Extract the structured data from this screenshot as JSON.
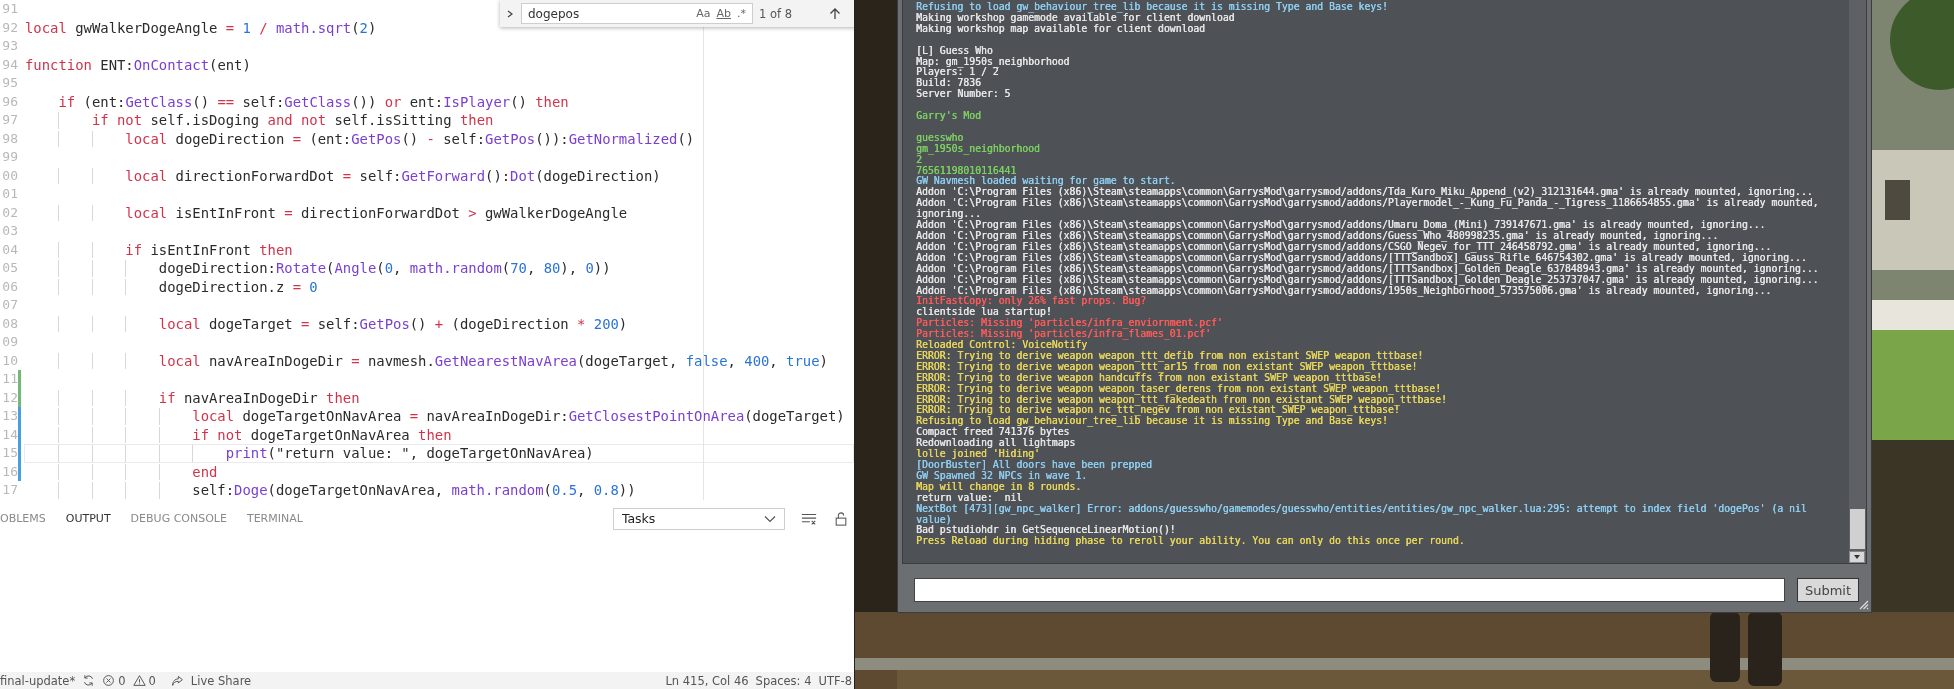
{
  "editor": {
    "lines": [
      {
        "number": "91",
        "current": false
      },
      {
        "number": "92",
        "current": false,
        "tokens": [
          {
            "kind": "keyword",
            "text": "local"
          },
          {
            "kind": "plain",
            "text": " gwWalkerDogeAngle"
          },
          {
            "kind": "operator",
            "text": " = "
          },
          {
            "kind": "number",
            "text": "1"
          },
          {
            "kind": "operator",
            "text": " / "
          },
          {
            "kind": "function",
            "text": "math.sqrt"
          },
          {
            "kind": "plain",
            "text": "("
          },
          {
            "kind": "number",
            "text": "2"
          },
          {
            "kind": "plain",
            "text": ")"
          }
        ]
      },
      {
        "number": "93",
        "current": false
      },
      {
        "number": "94",
        "current": false,
        "tokens": [
          {
            "kind": "keyword",
            "text": "function"
          },
          {
            "kind": "plain",
            "text": " ENT:"
          },
          {
            "kind": "function",
            "text": "OnContact"
          },
          {
            "kind": "plain",
            "text": "(ent)"
          }
        ]
      },
      {
        "number": "95",
        "current": false
      },
      {
        "number": "96",
        "current": false,
        "tokens": [
          {
            "kind": "keyword",
            "text": "    if"
          },
          {
            "kind": "plain",
            "text": " (ent:"
          },
          {
            "kind": "function",
            "text": "GetClass"
          },
          {
            "kind": "plain",
            "text": "()"
          },
          {
            "kind": "operator",
            "text": " == "
          },
          {
            "kind": "plain",
            "text": "self:"
          },
          {
            "kind": "function",
            "text": "GetClass"
          },
          {
            "kind": "plain",
            "text": "()) "
          },
          {
            "kind": "keyword",
            "text": "or"
          },
          {
            "kind": "plain",
            "text": " ent:"
          },
          {
            "kind": "function",
            "text": "IsPlayer"
          },
          {
            "kind": "plain",
            "text": "() "
          },
          {
            "kind": "keyword",
            "text": "then"
          }
        ]
      },
      {
        "number": "97",
        "current": false,
        "tokens": [
          {
            "kind": "keyword",
            "text": "        if not"
          },
          {
            "kind": "plain",
            "text": " self.isDoging "
          },
          {
            "kind": "keyword",
            "text": "and not"
          },
          {
            "kind": "plain",
            "text": " self.isSitting "
          },
          {
            "kind": "keyword",
            "text": "then"
          }
        ]
      },
      {
        "number": "98",
        "current": false,
        "tokens": [
          {
            "kind": "keyword",
            "text": "            local"
          },
          {
            "kind": "plain",
            "text": " dogeDirection"
          },
          {
            "kind": "operator",
            "text": " = "
          },
          {
            "kind": "plain",
            "text": "(ent:"
          },
          {
            "kind": "function",
            "text": "GetPos"
          },
          {
            "kind": "plain",
            "text": "()"
          },
          {
            "kind": "operator",
            "text": " - "
          },
          {
            "kind": "plain",
            "text": "self:"
          },
          {
            "kind": "function",
            "text": "GetPos"
          },
          {
            "kind": "plain",
            "text": "()):"
          },
          {
            "kind": "function",
            "text": "GetNormalized"
          },
          {
            "kind": "plain",
            "text": "()"
          }
        ]
      },
      {
        "number": "99",
        "current": false
      },
      {
        "number": "00",
        "current": false,
        "tokens": [
          {
            "kind": "keyword",
            "text": "            local"
          },
          {
            "kind": "plain",
            "text": " directionForwardDot"
          },
          {
            "kind": "operator",
            "text": " = "
          },
          {
            "kind": "plain",
            "text": "self:"
          },
          {
            "kind": "function",
            "text": "GetForward"
          },
          {
            "kind": "plain",
            "text": "():"
          },
          {
            "kind": "function",
            "text": "Dot"
          },
          {
            "kind": "plain",
            "text": "(dogeDirection)"
          }
        ]
      },
      {
        "number": "01",
        "current": false
      },
      {
        "number": "02",
        "current": false,
        "tokens": [
          {
            "kind": "keyword",
            "text": "            local"
          },
          {
            "kind": "plain",
            "text": " isEntInFront"
          },
          {
            "kind": "operator",
            "text": " = "
          },
          {
            "kind": "plain",
            "text": "directionForwardDot"
          },
          {
            "kind": "operator",
            "text": " > "
          },
          {
            "kind": "plain",
            "text": "gwWalkerDogeAngle"
          }
        ]
      },
      {
        "number": "03",
        "current": false
      },
      {
        "number": "04",
        "current": false,
        "tokens": [
          {
            "kind": "keyword",
            "text": "            if"
          },
          {
            "kind": "plain",
            "text": " isEntInFront "
          },
          {
            "kind": "keyword",
            "text": "then"
          }
        ]
      },
      {
        "number": "05",
        "current": false,
        "tokens": [
          {
            "kind": "plain",
            "text": "                dogeDirection:"
          },
          {
            "kind": "function",
            "text": "Rotate"
          },
          {
            "kind": "plain",
            "text": "("
          },
          {
            "kind": "function",
            "text": "Angle"
          },
          {
            "kind": "plain",
            "text": "("
          },
          {
            "kind": "number",
            "text": "0"
          },
          {
            "kind": "plain",
            "text": ", "
          },
          {
            "kind": "function",
            "text": "math.random"
          },
          {
            "kind": "plain",
            "text": "("
          },
          {
            "kind": "number",
            "text": "70"
          },
          {
            "kind": "plain",
            "text": ", "
          },
          {
            "kind": "number",
            "text": "80"
          },
          {
            "kind": "plain",
            "text": "), "
          },
          {
            "kind": "number",
            "text": "0"
          },
          {
            "kind": "plain",
            "text": "))"
          }
        ]
      },
      {
        "number": "06",
        "current": false,
        "tokens": [
          {
            "kind": "plain",
            "text": "                dogeDirection.z"
          },
          {
            "kind": "operator",
            "text": " = "
          },
          {
            "kind": "number",
            "text": "0"
          }
        ]
      },
      {
        "number": "07",
        "current": false
      },
      {
        "number": "08",
        "current": false,
        "tokens": [
          {
            "kind": "keyword",
            "text": "                local"
          },
          {
            "kind": "plain",
            "text": " dogeTarget"
          },
          {
            "kind": "operator",
            "text": " = "
          },
          {
            "kind": "plain",
            "text": "self:"
          },
          {
            "kind": "function",
            "text": "GetPos"
          },
          {
            "kind": "plain",
            "text": "()"
          },
          {
            "kind": "operator",
            "text": " + "
          },
          {
            "kind": "plain",
            "text": "(dogeDirection"
          },
          {
            "kind": "operator",
            "text": " * "
          },
          {
            "kind": "number",
            "text": "200"
          },
          {
            "kind": "plain",
            "text": ")"
          }
        ]
      },
      {
        "number": "09",
        "current": false
      },
      {
        "number": "10",
        "current": false,
        "tokens": [
          {
            "kind": "keyword",
            "text": "                local"
          },
          {
            "kind": "plain",
            "text": " navAreaInDogeDir"
          },
          {
            "kind": "operator",
            "text": " = "
          },
          {
            "kind": "plain",
            "text": "navmesh."
          },
          {
            "kind": "function",
            "text": "GetNearestNavArea"
          },
          {
            "kind": "plain",
            "text": "(dogeTarget, "
          },
          {
            "kind": "number",
            "text": "false"
          },
          {
            "kind": "plain",
            "text": ", "
          },
          {
            "kind": "number",
            "text": "400"
          },
          {
            "kind": "plain",
            "text": ", "
          },
          {
            "kind": "number",
            "text": "true"
          },
          {
            "kind": "plain",
            "text": ")"
          }
        ]
      },
      {
        "number": "11",
        "current": false,
        "kind": "added"
      },
      {
        "number": "12",
        "current": false,
        "kind": "added",
        "tokens": [
          {
            "kind": "keyword",
            "text": "                if"
          },
          {
            "kind": "plain",
            "text": " navAreaInDogeDir "
          },
          {
            "kind": "keyword",
            "text": "then"
          }
        ]
      },
      {
        "number": "13",
        "current": false,
        "kind": "modified",
        "tokens": [
          {
            "kind": "keyword",
            "text": "                    local"
          },
          {
            "kind": "plain",
            "text": " dogeTargetOnNavArea"
          },
          {
            "kind": "operator",
            "text": " = "
          },
          {
            "kind": "plain",
            "text": "navAreaInDogeDir:"
          },
          {
            "kind": "function",
            "text": "GetClosestPointOnArea"
          },
          {
            "kind": "plain",
            "text": "(dogeTarget)"
          }
        ]
      },
      {
        "number": "14",
        "current": false,
        "kind": "modified",
        "tokens": [
          {
            "kind": "keyword",
            "text": "                    if not"
          },
          {
            "kind": "plain",
            "text": " dogeTargetOnNavArea "
          },
          {
            "kind": "keyword",
            "text": "then"
          }
        ]
      },
      {
        "number": "15",
        "current": true,
        "kind": "modified",
        "tokens": [
          {
            "kind": "function",
            "text": "                        print"
          },
          {
            "kind": "plain",
            "text": "("
          },
          {
            "kind": "string",
            "text": "\"return value: \""
          },
          {
            "kind": "plain",
            "text": ", dogeTargetOnNavArea)"
          }
        ]
      },
      {
        "number": "16",
        "current": false,
        "kind": "modified",
        "tokens": [
          {
            "kind": "keyword",
            "text": "                    end"
          }
        ]
      },
      {
        "number": "17",
        "current": false,
        "tokens": [
          {
            "kind": "plain",
            "text": "                    self:"
          },
          {
            "kind": "function",
            "text": "Doge"
          },
          {
            "kind": "plain",
            "text": "(dogeTargetOnNavArea, "
          },
          {
            "kind": "function",
            "text": "math.random"
          },
          {
            "kind": "plain",
            "text": "("
          },
          {
            "kind": "number",
            "text": "0.5"
          },
          {
            "kind": "plain",
            "text": ", "
          },
          {
            "kind": "number",
            "text": "0.8"
          },
          {
            "kind": "plain",
            "text": "))"
          }
        ]
      }
    ]
  },
  "find_widget": {
    "query": "dogepos",
    "options": [
      "Aa",
      "Ab",
      ".*"
    ],
    "result": "1 of 8"
  },
  "panel": {
    "tabs": [
      {
        "label": "OBLEMS",
        "selected": false
      },
      {
        "label": "OUTPUT",
        "selected": true
      },
      {
        "label": "DEBUG CONSOLE",
        "selected": false
      },
      {
        "label": "TERMINAL",
        "selected": false
      }
    ],
    "dropdown": "Tasks"
  },
  "status_bar": {
    "branch": "final-update*",
    "errors": "0",
    "warnings": "0",
    "live_share": "Live Share",
    "position": "Ln 415, Col 46",
    "indentation": "Spaces: 4",
    "encoding": "UTF-8"
  },
  "console": {
    "lines": [
      {
        "kind": "text",
        "color": "#8ecdf0",
        "text": "Refusing to load gw_behaviour_tree_lib because it is missing Type and Base keys!"
      },
      {
        "kind": "text",
        "color": "#e6e6e6",
        "text": "Making workshop gamemode available for client download"
      },
      {
        "kind": "text",
        "color": "#e6e6e6",
        "text": "Making workshop map available for client download"
      },
      {
        "kind": "blank"
      },
      {
        "kind": "text",
        "color": "#e6e6e6",
        "text": "[L] Guess Who"
      },
      {
        "kind": "text",
        "color": "#e6e6e6",
        "text": "Map: gm_1950s_neighborhood"
      },
      {
        "kind": "text",
        "color": "#e6e6e6",
        "text": "Players: 1 / 2"
      },
      {
        "kind": "text",
        "color": "#e6e6e6",
        "text": "Build: 7836"
      },
      {
        "kind": "text",
        "color": "#e6e6e6",
        "text": "Server Number: 5"
      },
      {
        "kind": "blank"
      },
      {
        "kind": "text",
        "color": "#7ccf62",
        "text": "Garry's Mod"
      },
      {
        "kind": "blank"
      },
      {
        "kind": "text",
        "color": "#7ccf62",
        "text": "guesswho"
      },
      {
        "kind": "text",
        "color": "#7ccf62",
        "text": "gm_1950s_neighborhood"
      },
      {
        "kind": "text",
        "color": "#7ccf62",
        "text": "2"
      },
      {
        "kind": "text",
        "color": "#7ccf62",
        "text": "76561198010116441"
      },
      {
        "kind": "text",
        "color": "#8ecdf0",
        "text": "GW Navmesh loaded waiting for game to start."
      },
      {
        "kind": "text",
        "color": "#e6e6e6",
        "text": "Addon 'C:\\Program Files (x86)\\Steam\\steamapps\\common\\GarrysMod\\garrysmod/addons/Tda_Kuro_Miku_Append_(v2)_312131644.gma' is already mounted, ignoring..."
      },
      {
        "kind": "text",
        "color": "#e6e6e6",
        "text": "Addon 'C:\\Program Files (x86)\\Steam\\steamapps\\common\\GarrysMod\\garrysmod/addons/Playermodel_-_Kung_Fu_Panda_-_Tigress_1186654855.gma' is already mounted, ignoring..."
      },
      {
        "kind": "text",
        "color": "#e6e6e6",
        "text": "Addon 'C:\\Program Files (x86)\\Steam\\steamapps\\common\\GarrysMod\\garrysmod/addons/Umaru_Doma_(Mini)_739147671.gma' is already mounted, ignoring..."
      },
      {
        "kind": "text",
        "color": "#e6e6e6",
        "text": "Addon 'C:\\Program Files (x86)\\Steam\\steamapps\\common\\GarrysMod\\garrysmod/addons/Guess_Who_480998235.gma' is already mounted, ignoring..."
      },
      {
        "kind": "text",
        "color": "#e6e6e6",
        "text": "Addon 'C:\\Program Files (x86)\\Steam\\steamapps\\common\\GarrysMod\\garrysmod/addons/CSGO_Negev_for_TTT_246458792.gma' is already mounted, ignoring..."
      },
      {
        "kind": "text",
        "color": "#e6e6e6",
        "text": "Addon 'C:\\Program Files (x86)\\Steam\\steamapps\\common\\GarrysMod\\garrysmod/addons/[TTTSandbox]_Gauss_Rifle_646754302.gma' is already mounted, ignoring..."
      },
      {
        "kind": "text",
        "color": "#e6e6e6",
        "text": "Addon 'C:\\Program Files (x86)\\Steam\\steamapps\\common\\GarrysMod\\garrysmod/addons/[TTTSandbox]_Golden_Deagle_637848943.gma' is already mounted, ignoring..."
      },
      {
        "kind": "text",
        "color": "#e6e6e6",
        "text": "Addon 'C:\\Program Files (x86)\\Steam\\steamapps\\common\\GarrysMod\\garrysmod/addons/[TTTSandbox]_Golden_Deagle_253737047.gma' is already mounted, ignoring..."
      },
      {
        "kind": "text",
        "color": "#e6e6e6",
        "text": "Addon 'C:\\Program Files (x86)\\Steam\\steamapps\\common\\GarrysMod\\garrysmod/addons/1950s_Neighborhood_573575006.gma' is already mounted, ignoring..."
      },
      {
        "kind": "text",
        "color": "#ff5a5a",
        "text": "InitFastCopy: only 26% fast props. Bug?"
      },
      {
        "kind": "text",
        "color": "#e6e6e6",
        "text": "clientside lua startup!"
      },
      {
        "kind": "text",
        "color": "#ff5a5a",
        "text": "Particles: Missing 'particles/infra_enviornment.pcf'"
      },
      {
        "kind": "text",
        "color": "#ff5a5a",
        "text": "Particles: Missing 'particles/infra_flames_01.pcf'"
      },
      {
        "kind": "text",
        "color": "#e8d65c",
        "text": "Reloaded Control: VoiceNotify"
      },
      {
        "kind": "text",
        "color": "#e8d65c",
        "text": "ERROR: Trying to derive weapon weapon_ttt_defib from non existant SWEP weapon_tttbase!"
      },
      {
        "kind": "text",
        "color": "#e8d65c",
        "text": "ERROR: Trying to derive weapon weapon_ttt_ar15 from non existant SWEP weapon_tttbase!"
      },
      {
        "kind": "text",
        "color": "#e8d65c",
        "text": "ERROR: Trying to derive weapon handcuffs from non existant SWEP weapon_tttbase!"
      },
      {
        "kind": "text",
        "color": "#e8d65c",
        "text": "ERROR: Trying to derive weapon weapon_taser_derens from non existant SWEP weapon_tttbase!"
      },
      {
        "kind": "text",
        "color": "#e8d65c",
        "text": "ERROR: Trying to derive weapon weapon_ttt_fakedeath from non existant SWEP weapon_tttbase!"
      },
      {
        "kind": "text",
        "color": "#e8d65c",
        "text": "ERROR: Trying to derive weapon nc_ttt_negev from non existant SWEP weapon_tttbase!"
      },
      {
        "kind": "text",
        "color": "#e8d65c",
        "text": "Refusing to load gw_behaviour_tree_lib because it is missing Type and Base keys!"
      },
      {
        "kind": "text",
        "color": "#e6e6e6",
        "text": "Compact freed 741376 bytes"
      },
      {
        "kind": "text",
        "color": "#e6e6e6",
        "text": "Redownloading all lightmaps"
      },
      {
        "kind": "text",
        "color": "#e8d65c",
        "text": "lolle joined 'Hiding'"
      },
      {
        "kind": "text",
        "color": "#8ecdf0",
        "text": "[DoorBuster] All doors have been prepped"
      },
      {
        "kind": "text",
        "color": "#8ecdf0",
        "text": "GW Spawned 32 NPCs in wave 1."
      },
      {
        "kind": "text",
        "color": "#e8d65c",
        "text": "Map will change in 8 rounds."
      },
      {
        "kind": "text",
        "color": "#e6e6e6",
        "text": "return value:  nil"
      },
      {
        "kind": "text",
        "color": "#8ecdf0",
        "text": "NextBot [473][gw_npc_walker] Error: addons/guesswho/gamemodes/guesswho/entities/entities/gw_npc_walker.lua:295: attempt to index field 'dogePos' (a nil value)"
      },
      {
        "kind": "text",
        "color": "#e6e6e6",
        "text": "Bad pstudiohdr in GetSequenceLinearMotion()!"
      },
      {
        "kind": "text",
        "color": "#e8d65c",
        "text": "Press Reload during hiding phase to reroll your ability. You can only do this once per round."
      }
    ],
    "submit": "Submit"
  }
}
